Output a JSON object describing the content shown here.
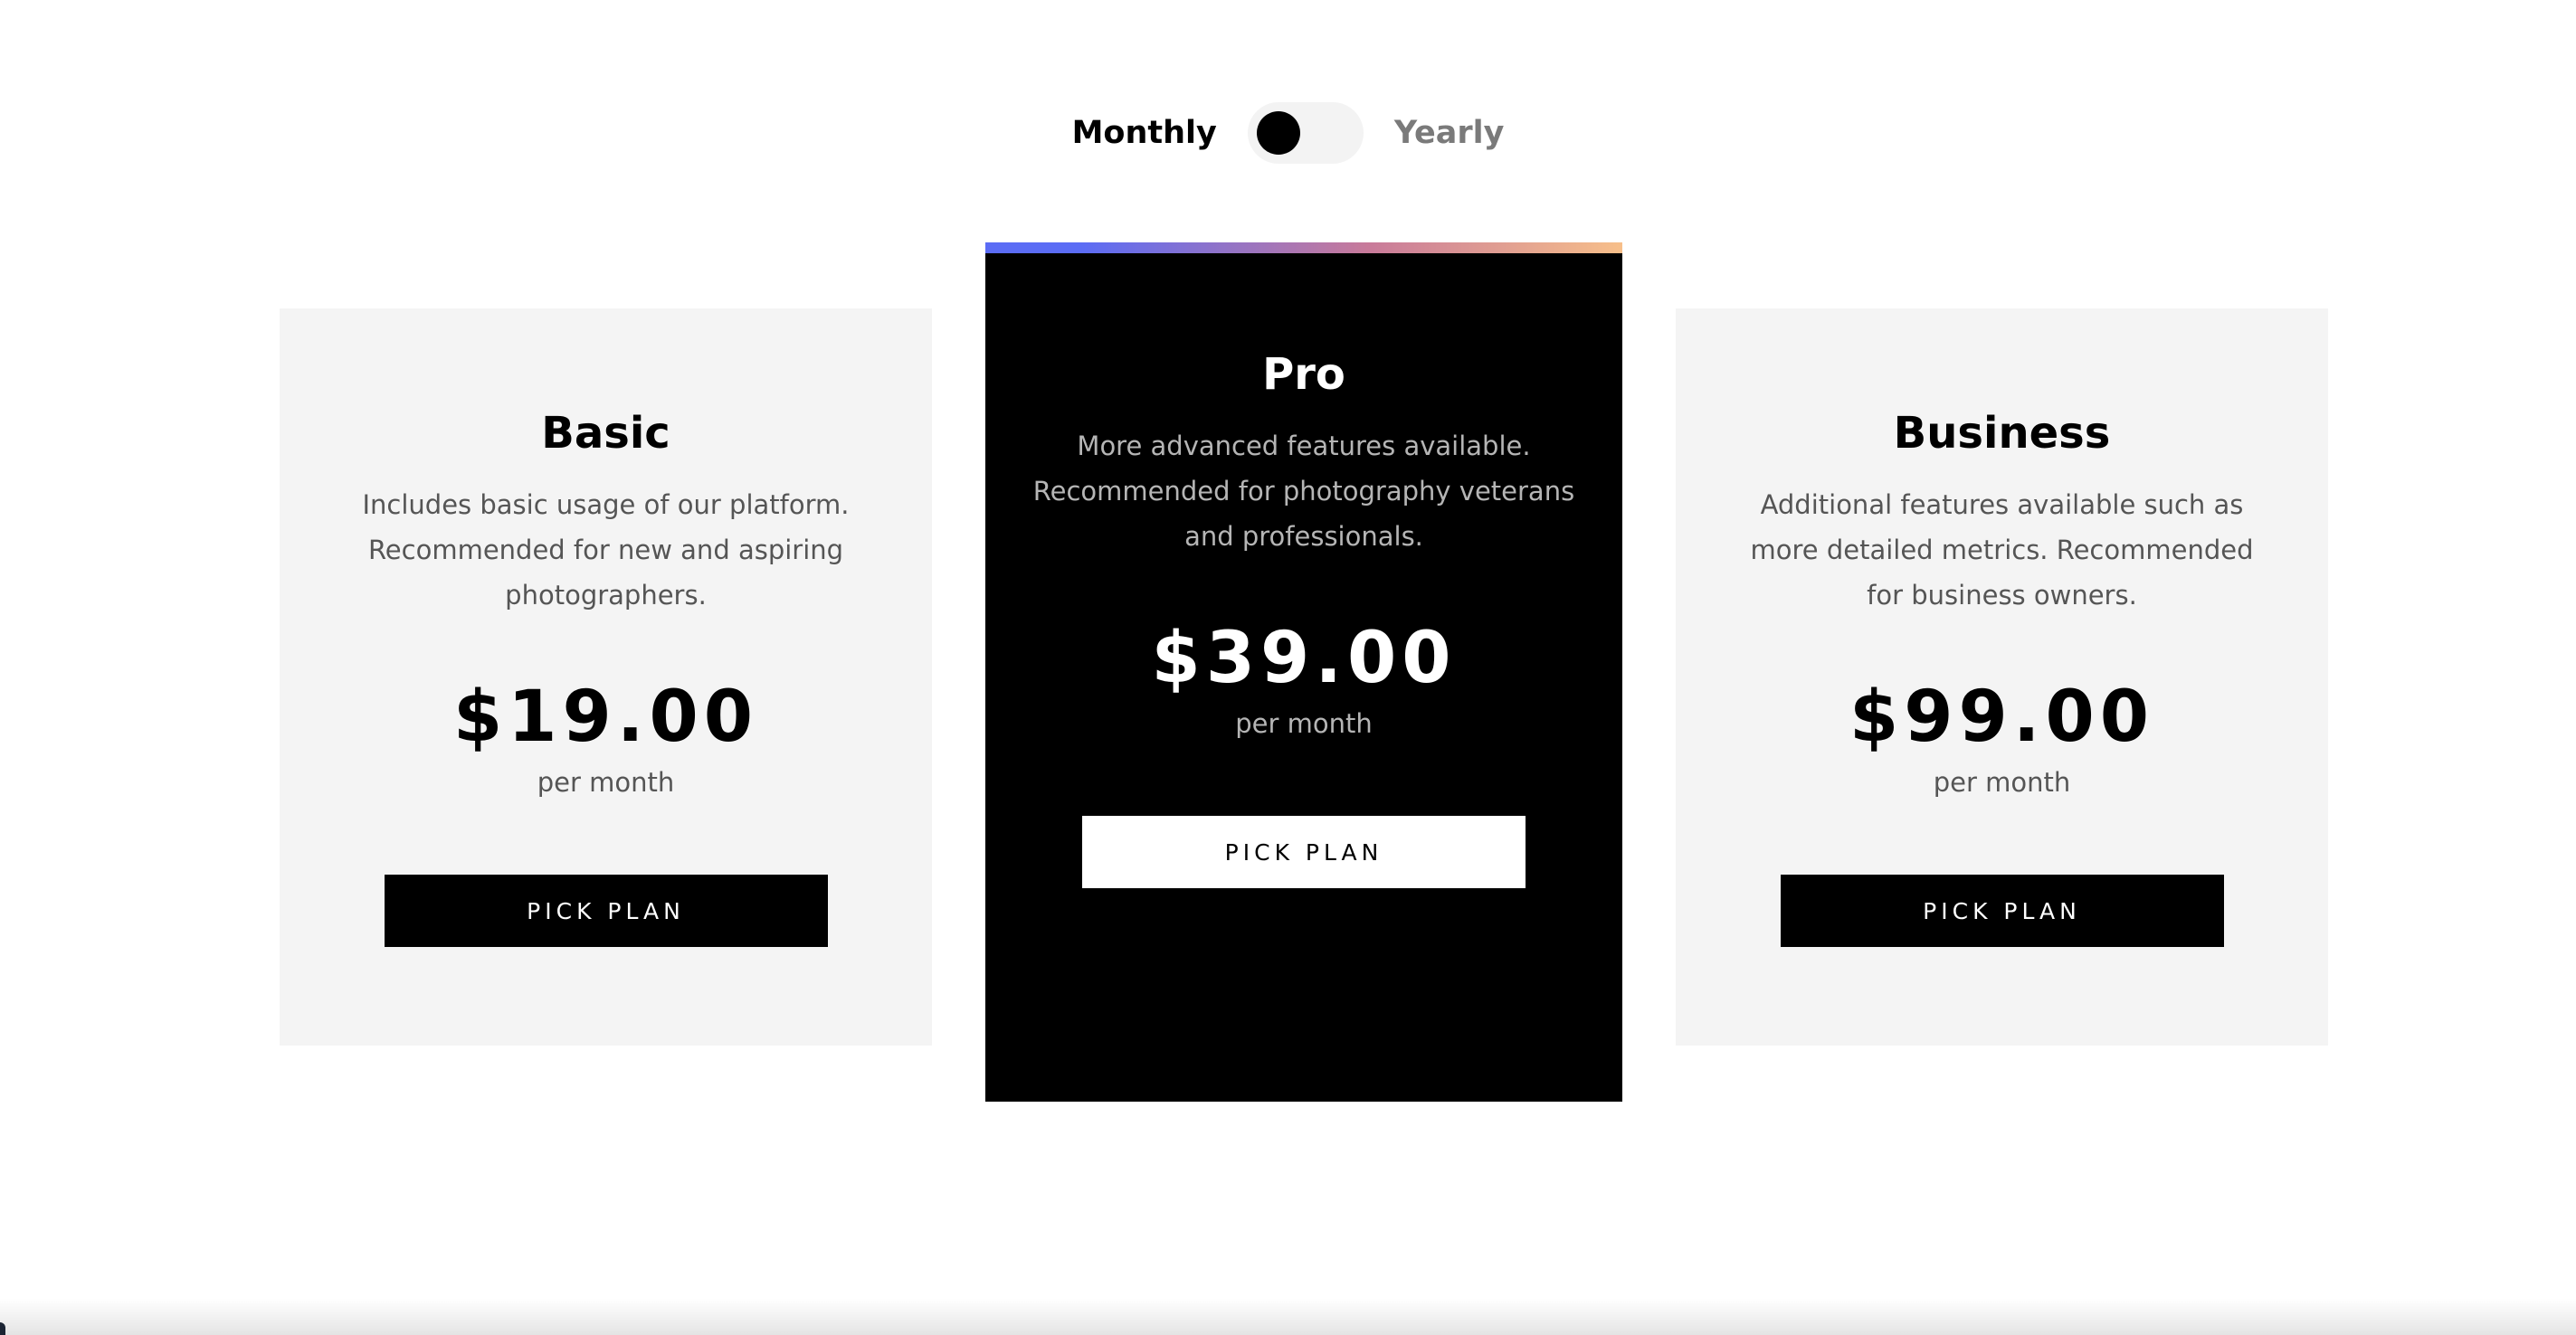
{
  "billing": {
    "monthly_label": "Monthly",
    "yearly_label": "Yearly",
    "selected": "Monthly"
  },
  "plans": [
    {
      "name": "Basic",
      "description": "Includes basic usage of our platform. Recommended for new and aspiring photographers.",
      "price": "$19.00",
      "period": "per month",
      "button_label": "PICK PLAN"
    },
    {
      "name": "Pro",
      "description": "More advanced features available. Recommended for photography veterans and professionals.",
      "price": "$39.00",
      "period": "per month",
      "button_label": "PICK PLAN"
    },
    {
      "name": "Business",
      "description": "Additional features available such as more detailed metrics. Recommended for business owners.",
      "price": "$99.00",
      "period": "per month",
      "button_label": "PICK PLAN"
    }
  ],
  "colors": {
    "featured_gradient_start": "#5b6cf5",
    "featured_gradient_mid": "#c87a9a",
    "featured_gradient_end": "#f7bf8a",
    "card_light_bg": "#f4f4f4",
    "card_dark_bg": "#000000"
  }
}
